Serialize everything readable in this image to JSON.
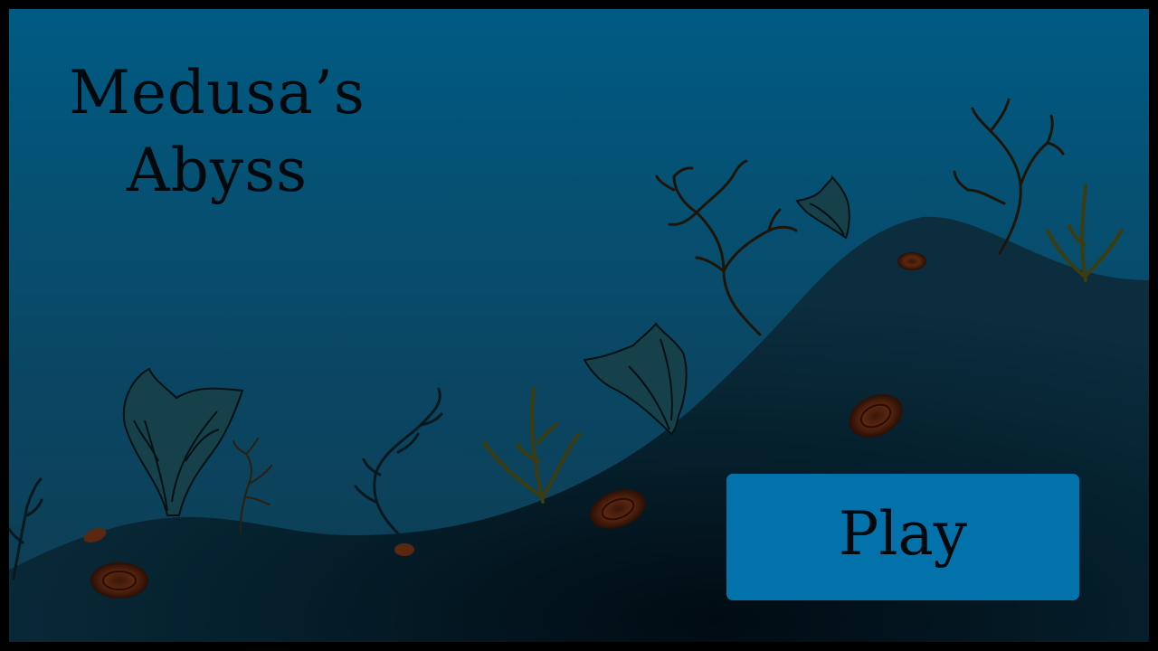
{
  "game": {
    "title_line_1": "Medusa’s",
    "title_line_2": "Abyss",
    "play_label": "Play"
  },
  "colors": {
    "water_top": "#005b84",
    "water_bottom": "#0e3c52",
    "seabed": "#0c2d3d",
    "seabed_shadow": "#010b12",
    "play_button": "#0372aa",
    "text": "#02080c",
    "rock": "#4a1f0e",
    "kelp": "#16404a",
    "weed": "#3b3d10",
    "coral": "#2a1a0c"
  },
  "icons": {
    "kelp": "kelp-icon",
    "coral": "branching-coral-icon",
    "seaweed": "seaweed-icon",
    "rock": "rock-icon"
  }
}
